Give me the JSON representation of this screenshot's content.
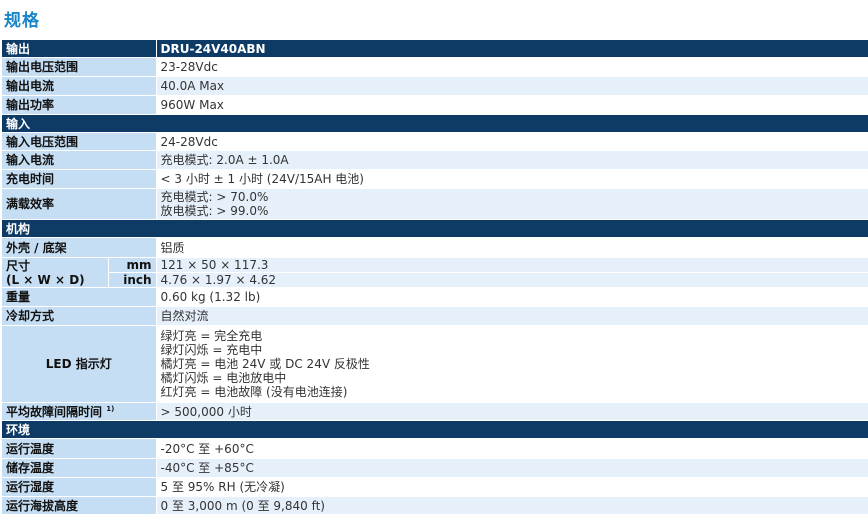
{
  "title": "规格",
  "sections": {
    "output": {
      "label": "输出",
      "model": "DRU-24V40ABN",
      "rows": {
        "voltage_range": {
          "label": "输出电压范围",
          "value": "23-28Vdc"
        },
        "current": {
          "label": "输出电流",
          "value": "40.0A Max"
        },
        "power": {
          "label": "输出功率",
          "value": "960W Max"
        }
      }
    },
    "input": {
      "label": "输入",
      "rows": {
        "voltage_range": {
          "label": "输入电压范围",
          "value": "24-28Vdc"
        },
        "current": {
          "label": "输入电流",
          "value": "充电模式: 2.0A ± 1.0A"
        },
        "charge_time": {
          "label": "充电时间",
          "value": "< 3 小时 ± 1 小时 (24V/15AH 电池)"
        },
        "efficiency": {
          "label": "满载效率",
          "lines": [
            "充电模式: > 70.0%",
            "放电模式: > 99.0%"
          ]
        }
      }
    },
    "mechanical": {
      "label": "机构",
      "rows": {
        "housing": {
          "label": "外壳 / 底架",
          "value": "铝质"
        },
        "dimensions": {
          "label1": "尺寸",
          "label2": "(L × W × D)",
          "unit_mm": "mm",
          "value_mm": "121 × 50 × 117.3",
          "unit_inch": "inch",
          "value_inch": "4.76 × 1.97 × 4.62"
        },
        "weight": {
          "label": "重量",
          "value": "0.60 kg  (1.32 lb)"
        },
        "cooling": {
          "label": "冷却方式",
          "value": "自然对流"
        },
        "led": {
          "label": "LED 指示灯",
          "lines": [
            "绿灯亮 = 完全充电",
            "绿灯闪烁 = 充电中",
            "橘灯亮 = 电池 24V 或 DC 24V 反极性",
            "橘灯闪烁 = 电池放电中",
            "红灯亮 = 电池故障 (没有电池连接)"
          ]
        },
        "mtbf": {
          "label": "平均故障间隔时间",
          "footnote": "1)",
          "value": "> 500,000 小时"
        }
      }
    },
    "environment": {
      "label": "环境",
      "rows": {
        "operating_temp": {
          "label": "运行温度",
          "value": "-20°C 至 +60°C"
        },
        "storage_temp": {
          "label": "储存温度",
          "value": "-40°C 至 +85°C"
        },
        "humidity": {
          "label": "运行湿度",
          "value": "5 至 95% RH (无冷凝)"
        },
        "altitude": {
          "label": "运行海拔高度",
          "value": "0 至 3,000 m (0 至 9,840 ft)"
        }
      }
    }
  }
}
